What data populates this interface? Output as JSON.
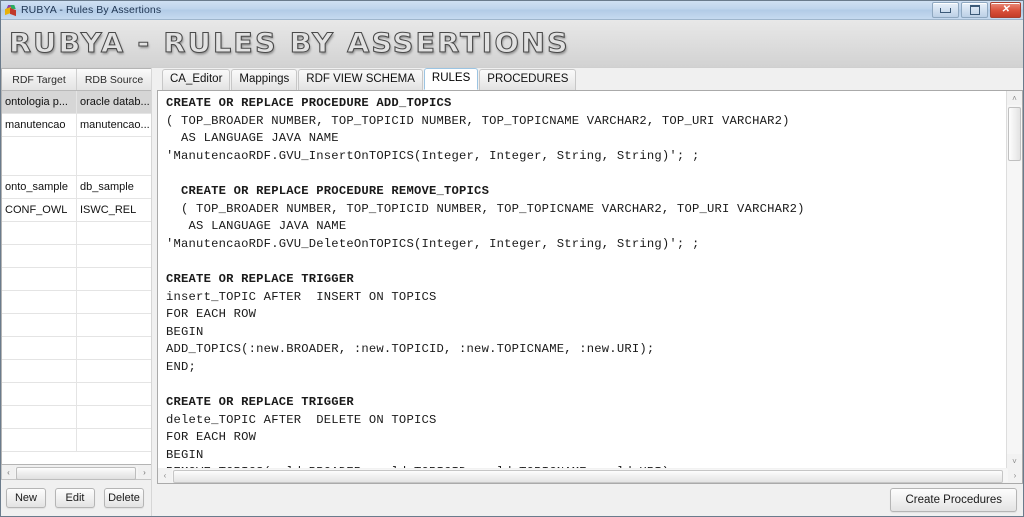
{
  "window": {
    "title": "RUBYA - Rules By Assertions",
    "icon": "app-cube-icon",
    "minimize_glyph": "minimize-icon",
    "maximize_glyph": "maximize-icon",
    "close_glyph": "✕"
  },
  "banner": {
    "logo_text": "RUBYA - RULES BY ASSERTIONS"
  },
  "sidebar": {
    "columns": [
      "RDF Target",
      "RDB Source"
    ],
    "rows": [
      {
        "target": "ontologia p...",
        "source": "oracle datab...",
        "selected": true,
        "tall": false
      },
      {
        "target": "manutencao",
        "source": "manutencao...",
        "selected": false,
        "tall": false
      },
      {
        "target": "",
        "source": "",
        "selected": false,
        "tall": true
      },
      {
        "target": "onto_sample",
        "source": "db_sample",
        "selected": false,
        "tall": false
      },
      {
        "target": "CONF_OWL",
        "source": "ISWC_REL",
        "selected": false,
        "tall": false
      },
      {
        "target": "",
        "source": "",
        "selected": false,
        "tall": false
      },
      {
        "target": "",
        "source": "",
        "selected": false,
        "tall": false
      },
      {
        "target": "",
        "source": "",
        "selected": false,
        "tall": false
      },
      {
        "target": "",
        "source": "",
        "selected": false,
        "tall": false
      },
      {
        "target": "",
        "source": "",
        "selected": false,
        "tall": false
      },
      {
        "target": "",
        "source": "",
        "selected": false,
        "tall": false
      },
      {
        "target": "",
        "source": "",
        "selected": false,
        "tall": false
      },
      {
        "target": "",
        "source": "",
        "selected": false,
        "tall": false
      },
      {
        "target": "",
        "source": "",
        "selected": false,
        "tall": false
      },
      {
        "target": "",
        "source": "",
        "selected": false,
        "tall": false
      }
    ],
    "hscroll": {
      "left_arrow": "‹",
      "right_arrow": "›"
    },
    "buttons": {
      "new": "New",
      "edit": "Edit",
      "delete": "Delete"
    }
  },
  "tabs": [
    {
      "label": "CA_Editor",
      "active": false
    },
    {
      "label": "Mappings",
      "active": false
    },
    {
      "label": "RDF VIEW SCHEMA",
      "active": false
    },
    {
      "label": "RULES",
      "active": true
    },
    {
      "label": "PROCEDURES",
      "active": false
    }
  ],
  "editor": {
    "scroll_up_arrow": "˄",
    "scroll_down_arrow": "˅",
    "scroll_left_arrow": "‹",
    "scroll_right_arrow": "›",
    "lines": [
      {
        "text": "CREATE OR REPLACE PROCEDURE ADD_TOPICS",
        "bold": true
      },
      {
        "text": "( TOP_BROADER NUMBER, TOP_TOPICID NUMBER, TOP_TOPICNAME VARCHAR2, TOP_URI VARCHAR2)",
        "bold": false
      },
      {
        "text": "  AS LANGUAGE JAVA NAME",
        "bold": false
      },
      {
        "text": "'ManutencaoRDF.GVU_InsertOnTOPICS(Integer, Integer, String, String)'; ;",
        "bold": false
      },
      {
        "text": "",
        "bold": false
      },
      {
        "text": "  CREATE OR REPLACE PROCEDURE REMOVE_TOPICS",
        "bold": true
      },
      {
        "text": "  ( TOP_BROADER NUMBER, TOP_TOPICID NUMBER, TOP_TOPICNAME VARCHAR2, TOP_URI VARCHAR2)",
        "bold": false
      },
      {
        "text": "   AS LANGUAGE JAVA NAME",
        "bold": false
      },
      {
        "text": "'ManutencaoRDF.GVU_DeleteOnTOPICS(Integer, Integer, String, String)'; ;",
        "bold": false
      },
      {
        "text": "",
        "bold": false
      },
      {
        "text": "CREATE OR REPLACE TRIGGER",
        "bold": true
      },
      {
        "text": "insert_TOPIC AFTER  INSERT ON TOPICS",
        "bold": false
      },
      {
        "text": "FOR EACH ROW",
        "bold": false
      },
      {
        "text": "BEGIN",
        "bold": false
      },
      {
        "text": "ADD_TOPICS(:new.BROADER, :new.TOPICID, :new.TOPICNAME, :new.URI);",
        "bold": false
      },
      {
        "text": "END;",
        "bold": false
      },
      {
        "text": "",
        "bold": false
      },
      {
        "text": "CREATE OR REPLACE TRIGGER",
        "bold": true
      },
      {
        "text": "delete_TOPIC AFTER  DELETE ON TOPICS",
        "bold": false
      },
      {
        "text": "FOR EACH ROW",
        "bold": false
      },
      {
        "text": "BEGIN",
        "bold": false
      },
      {
        "text": "REMOVE TOPICS(:old.BROADER, :old.TOPICID, :old.TOPICNAME, :old.URI);",
        "bold": false
      }
    ]
  },
  "footer": {
    "create_procedures": "Create Procedures"
  }
}
